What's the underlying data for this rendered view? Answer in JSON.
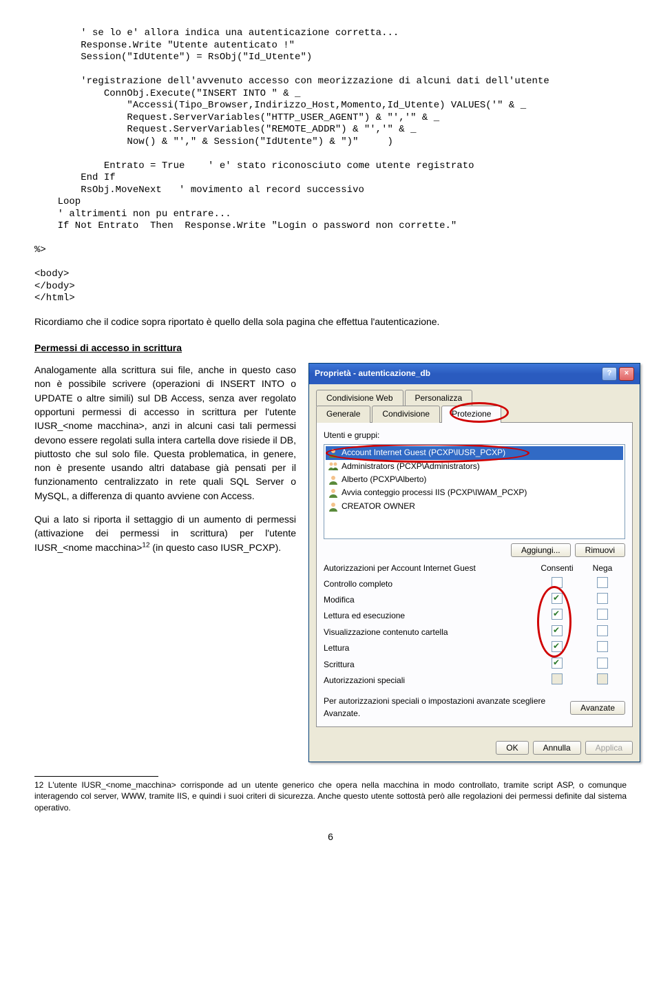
{
  "code": {
    "l1": "        ' se lo e' allora indica una autenticazione corretta...",
    "l2": "        Response.Write \"Utente autenticato !\"",
    "l3": "        Session(\"IdUtente\") = RsObj(\"Id_Utente\")",
    "l4": "",
    "l5": "        'registrazione dell'avvenuto accesso con meorizzazione di alcuni dati dell'utente",
    "l6": "            ConnObj.Execute(\"INSERT INTO \" & _",
    "l7": "                \"Accessi(Tipo_Browser,Indirizzo_Host,Momento,Id_Utente) VALUES('\" & _",
    "l8": "                Request.ServerVariables(\"HTTP_USER_AGENT\") & \"','\" & _",
    "l9": "                Request.ServerVariables(\"REMOTE_ADDR\") & \"','\" & _",
    "l10": "                Now() & \"',\" & Session(\"IdUtente\") & \")\"     )",
    "l11": "",
    "l12": "            Entrato = True    ' e' stato riconosciuto come utente registrato",
    "l13": "        End If",
    "l14": "        RsObj.MoveNext   ' movimento al record successivo",
    "l15": "    Loop",
    "l16": "    ' altrimenti non pu entrare...",
    "l17": "    If Not Entrato  Then  Response.Write \"Login o password non corrette.\"",
    "l18": "",
    "l19": "%>",
    "l20": "",
    "l21": "<body>",
    "l22": "</body>",
    "l23": "</html>"
  },
  "text": {
    "body1": "Ricordiamo che il codice sopra riportato è quello della sola pagina che effettua l'autenticazione.",
    "section_title": "Permessi di accesso in scrittura",
    "body2a": "Analogamente alla scrittura sui file, anche in questo caso non è  possibile scrivere (operazioni di INSERT INTO o UPDATE o altre simili) sul DB Access, senza aver regolato opportuni permessi di accesso in scrittura per l'utente IUSR_<nome macchina>, anzi in alcuni casi tali permessi devono essere regolati sulla intera cartella dove risiede il DB, piuttosto che sul solo file.  Questa problematica, in genere, non è presente usando altri database già pensati per il funzionamento centralizzato in rete quali SQL Server o MySQL, a differenza di quanto avviene con Access.",
    "body2b": "Qui a lato si riporta il settaggio di un aumento di permessi (attivazione dei permessi in scrittura) per l'utente IUSR_<nome macchina>",
    "body2c": " (in questo caso IUSR_PCXP).",
    "footnote_num": "12",
    "footnote": "L'utente IUSR_<nome_macchina> corrisponde ad un utente generico che opera nella macchina in modo controllato, tramite script ASP, o comunque interagendo col server, WWW, tramite IIS, e quindi i suoi criteri di sicurezza.  Anche questo utente sottostà però alle regolazioni dei permessi definite dal sistema operativo.",
    "page_num": "6"
  },
  "dialog": {
    "title": "Proprietà - autenticazione_db",
    "tabs": {
      "t1": "Condivisione Web",
      "t2": "Personalizza",
      "t3": "Generale",
      "t4": "Condivisione",
      "t5": "Protezione"
    },
    "label_users": "Utenti e gruppi:",
    "users": {
      "u1": "Account Internet Guest (PCXP\\IUSR_PCXP)",
      "u2": "Administrators (PCXP\\Administrators)",
      "u3": "Alberto (PCXP\\Alberto)",
      "u4": "Avvia conteggio processi IIS (PCXP\\IWAM_PCXP)",
      "u5": "CREATOR OWNER"
    },
    "btn_add": "Aggiungi...",
    "btn_remove": "Rimuovi",
    "perm_label": "Autorizzazioni per Account Internet Guest",
    "col_allow": "Consenti",
    "col_deny": "Nega",
    "perms": {
      "p1": "Controllo completo",
      "p2": "Modifica",
      "p3": "Lettura ed esecuzione",
      "p4": "Visualizzazione contenuto cartella",
      "p5": "Lettura",
      "p6": "Scrittura",
      "p7": "Autorizzazioni speciali"
    },
    "adv_text": "Per autorizzazioni speciali o impostazioni avanzate scegliere Avanzate.",
    "btn_adv": "Avanzate",
    "btn_ok": "OK",
    "btn_cancel": "Annulla",
    "btn_apply": "Applica"
  }
}
